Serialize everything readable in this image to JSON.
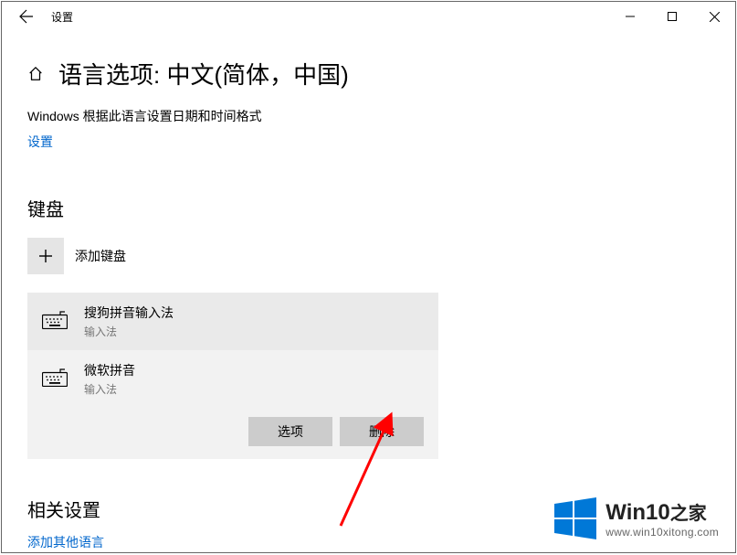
{
  "titlebar": {
    "title": "设置"
  },
  "header": {
    "page_title": "语言选项: 中文(简体，中国)",
    "info": "Windows 根据此语言设置日期和时间格式",
    "settings_link": "设置"
  },
  "keyboard": {
    "heading": "键盘",
    "add_label": "添加键盘",
    "items": [
      {
        "name": "搜狗拼音输入法",
        "sub": "输入法"
      },
      {
        "name": "微软拼音",
        "sub": "输入法"
      }
    ],
    "options_label": "选项",
    "delete_label": "删除"
  },
  "related": {
    "heading": "相关设置",
    "add_other_link": "添加其他语言"
  },
  "watermark": {
    "title_main": "Win10",
    "title_suffix": "之家",
    "url": "www.win10xitong.com"
  }
}
